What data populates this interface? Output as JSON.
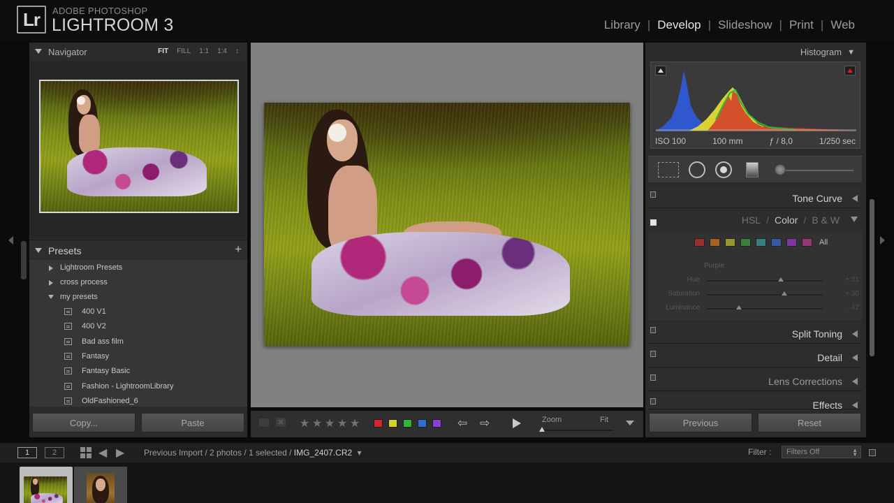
{
  "app": {
    "logo": "Lr",
    "brand_small": "ADOBE PHOTOSHOP",
    "brand_big": "LIGHTROOM 3"
  },
  "modules": [
    {
      "label": "Library",
      "active": false
    },
    {
      "label": "Develop",
      "active": true
    },
    {
      "label": "Slideshow",
      "active": false
    },
    {
      "label": "Print",
      "active": false
    },
    {
      "label": "Web",
      "active": false
    }
  ],
  "navigator": {
    "title": "Navigator",
    "zoom_options": [
      "FIT",
      "FILL",
      "1:1",
      "1:4"
    ],
    "active_zoom": "FIT",
    "zoom_arrows": "↕"
  },
  "presets": {
    "title": "Presets",
    "add_glyph": "+",
    "folders": [
      {
        "label": "Lightroom Presets",
        "expanded": false
      },
      {
        "label": "cross process",
        "expanded": false
      },
      {
        "label": "my presets",
        "expanded": true
      }
    ],
    "items": [
      "400 V1",
      "400 V2",
      "Bad ass film",
      "Fantasy",
      "Fantasy Basic",
      "Fashion - LightroomLibrary",
      "OldFashioned_6"
    ]
  },
  "left_buttons": {
    "copy": "Copy...",
    "paste": "Paste"
  },
  "toolbar": {
    "rating_glyph": "★",
    "rating_count": 5,
    "flag_reject_glyph": "✖",
    "color_labels": [
      "#d4252b",
      "#d6d220",
      "#2fb53b",
      "#2f6fd4",
      "#8a3fd6"
    ],
    "prev_glyph": "⇦",
    "next_glyph": "⇨",
    "zoom_label": "Zoom",
    "zoom_value": "Fit",
    "zoom_level": 0.0
  },
  "histogram": {
    "title": "Histogram",
    "collapse_glyph": "▼",
    "exif": {
      "iso": "ISO 100",
      "focal": "100 mm",
      "aperture": "ƒ / 8,0",
      "shutter": "1/250 sec"
    }
  },
  "panels": {
    "tone_curve": "Tone Curve",
    "hsl_tabs": [
      "HSL",
      "Color",
      "B & W"
    ],
    "hsl_active": "Color",
    "split_toning": "Split Toning",
    "detail": "Detail",
    "lens_corrections": "Lens Corrections",
    "effects": "Effects"
  },
  "color_panel": {
    "swatches": [
      "#c03030",
      "#d07a20",
      "#c8c030",
      "#3ea040",
      "#3aa0a0",
      "#3a6ad0",
      "#9a3ad0",
      "#c03a90"
    ],
    "all_label": "All",
    "selected_color": "Purple",
    "sliders": [
      {
        "label": "Hue",
        "value": "+ 31",
        "level": 0.64
      },
      {
        "label": "Saturation",
        "value": "+ 30",
        "level": 0.67
      },
      {
        "label": "Luminance",
        "value": "- 42",
        "level": 0.28
      }
    ]
  },
  "right_buttons": {
    "previous": "Previous",
    "reset": "Reset"
  },
  "filmstrip_bar": {
    "screen1": "1",
    "screen2": "2",
    "prev_glyph": "◀",
    "next_glyph": "▶",
    "breadcrumb": "Previous Import / 2 photos / 1 selected / ",
    "filename": "IMG_2407.CR2",
    "filename_arrow": "▾",
    "filter_label": "Filter :",
    "filter_value": "Filters Off"
  },
  "accent": "#e6e6e6"
}
